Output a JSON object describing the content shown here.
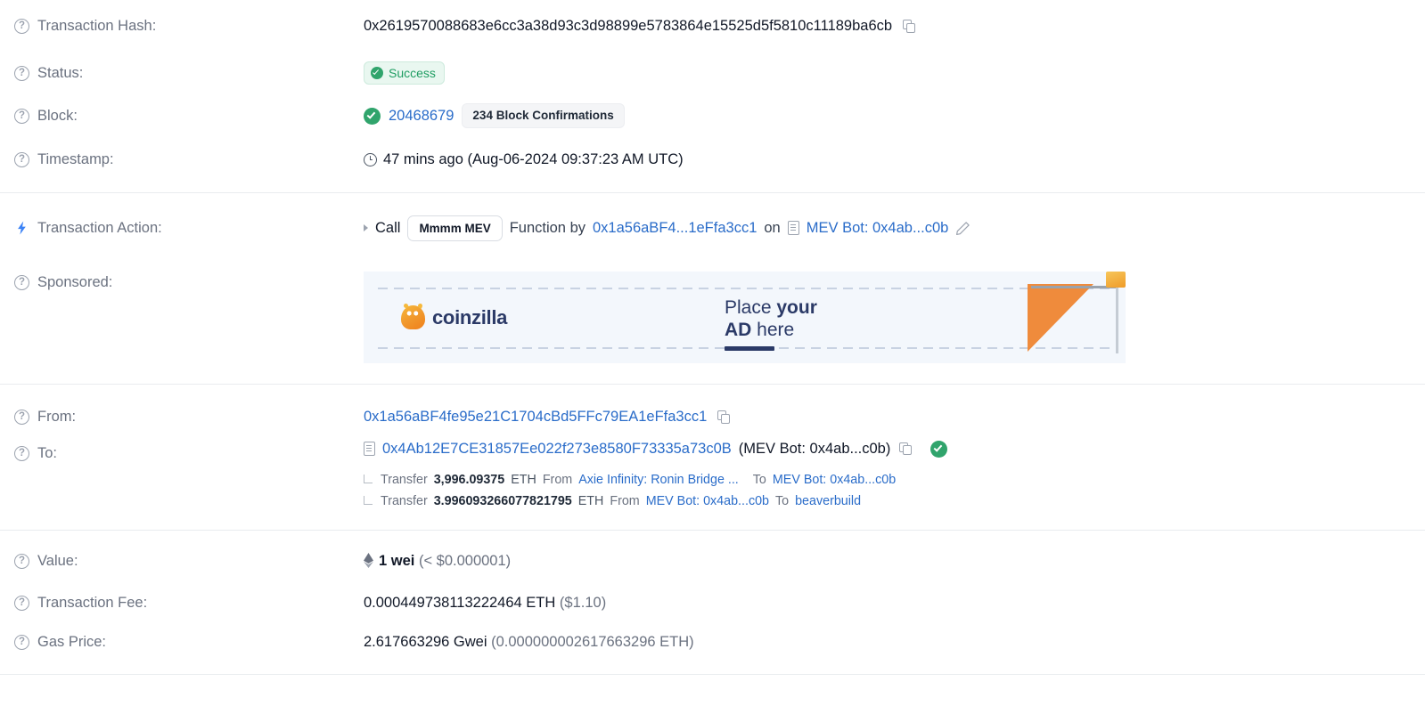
{
  "rows": {
    "tx_hash": {
      "label": "Transaction Hash:",
      "value": "0x2619570088683e6cc3a38d93c3d98899e5783864e15525d5f5810c11189ba6cb"
    },
    "status": {
      "label": "Status:",
      "badge": "Success"
    },
    "block": {
      "label": "Block:",
      "number": "20468679",
      "confirmations": "234 Block Confirmations"
    },
    "timestamp": {
      "label": "Timestamp:",
      "value": "47 mins ago (Aug-06-2024 09:37:23 AM UTC)"
    },
    "tx_action": {
      "label": "Transaction Action:",
      "call_word": "Call",
      "method_chip": "Mmmm MEV",
      "function_by": "Function by",
      "from_address": "0x1a56aBF4...1eFfa3cc1",
      "on_word": "on",
      "contract": "MEV Bot: 0x4ab...c0b"
    },
    "sponsored": {
      "label": "Sponsored:",
      "ad_brand": "coinzilla",
      "ad_line1_light": "Place ",
      "ad_line1_bold": "your",
      "ad_line2_bold": "AD ",
      "ad_line2_light": "here"
    },
    "from": {
      "label": "From:",
      "address": "0x1a56aBF4fe95e21C1704cBd5FFc79EA1eFfa3cc1"
    },
    "to": {
      "label": "To:",
      "address": "0x4Ab12E7CE31857Ee022f273e8580F73335a73c0B",
      "alias": "(MEV Bot: 0x4ab...c0b)"
    },
    "transfers": [
      {
        "word": "Transfer",
        "amount": "3,996.09375",
        "unit": "ETH",
        "from_word": "From",
        "from_name": "Axie Infinity: Ronin Bridge ...",
        "to_word": "To",
        "to_name": "MEV Bot: 0x4ab...c0b"
      },
      {
        "word": "Transfer",
        "amount": "3.996093266077821795",
        "unit": "ETH",
        "from_word": "From",
        "from_name": "MEV Bot: 0x4ab...c0b",
        "to_word": "To",
        "to_name": "beaverbuild"
      }
    ],
    "value": {
      "label": "Value:",
      "amount": "1 wei",
      "fiat": "(< $0.000001)"
    },
    "tx_fee": {
      "label": "Transaction Fee:",
      "amount": "0.000449738113222464 ETH",
      "fiat": "($1.10)"
    },
    "gas_price": {
      "label": "Gas Price:",
      "amount": "2.617663296 Gwei",
      "eth": "(0.000000002617663296 ETH)"
    }
  },
  "colors": {
    "link": "#2a6cc9",
    "success": "#30a46c",
    "label": "#6b7280",
    "divider": "#e9ecef",
    "ad_bg": "#f3f7fc",
    "ad_ink": "#2b3a67",
    "ad_orange": "#ef8b3c"
  }
}
